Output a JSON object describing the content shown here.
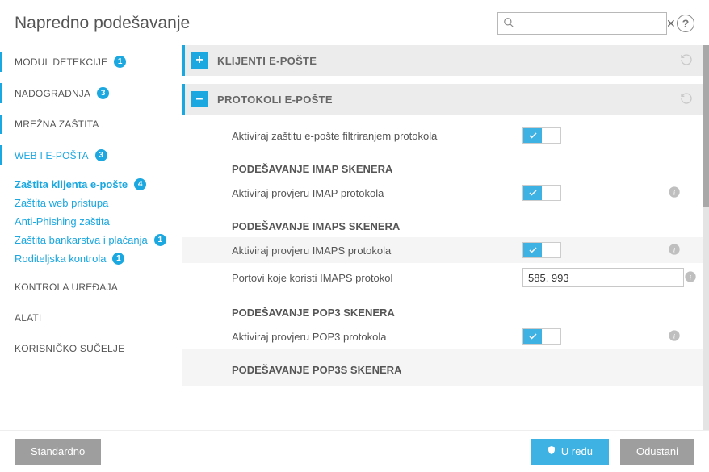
{
  "header": {
    "title": "Napredno podešavanje",
    "search_placeholder": ""
  },
  "sidebar": {
    "items": [
      {
        "label": "MODUL DETEKCIJE",
        "badge": "1"
      },
      {
        "label": "NADOGRADNJA",
        "badge": "3"
      },
      {
        "label": "MREŽNA ZAŠTITA"
      },
      {
        "label": "WEB I E-POŠTA",
        "badge": "3"
      },
      {
        "label": "KONTROLA UREĐAJA"
      },
      {
        "label": "ALATI"
      },
      {
        "label": "KORISNIČKO SUČELJE"
      }
    ],
    "subitems": [
      {
        "label": "Zaštita klijenta e-pošte",
        "badge": "4"
      },
      {
        "label": "Zaštita web pristupa"
      },
      {
        "label": "Anti-Phishing zaštita"
      },
      {
        "label": "Zaštita bankarstva i plaćanja",
        "badge": "1"
      },
      {
        "label": "Roditeljska kontrola",
        "badge": "1"
      }
    ]
  },
  "content": {
    "section1_title": "KLIJENTI E-POŠTE",
    "section2_title": "PROTOKOLI E-POŠTE",
    "filter_label": "Aktiviraj zaštitu e-pošte filtriranjem protokola",
    "imap_heading": "PODEŠAVANJE IMAP SKENERA",
    "imap_label": "Aktiviraj provjeru IMAP protokola",
    "imaps_heading": "PODEŠAVANJE IMAPS SKENERA",
    "imaps_label": "Aktiviraj provjeru IMAPS protokola",
    "imaps_ports_label": "Portovi koje koristi IMAPS protokol",
    "imaps_ports_value": "585, 993",
    "pop3_heading": "PODEŠAVANJE POP3 SKENERA",
    "pop3_label": "Aktiviraj provjeru POP3 protokola",
    "pop3s_heading": "PODEŠAVANJE POP3S SKENERA"
  },
  "footer": {
    "default_label": "Standardno",
    "ok_label": "U redu",
    "cancel_label": "Odustani"
  }
}
